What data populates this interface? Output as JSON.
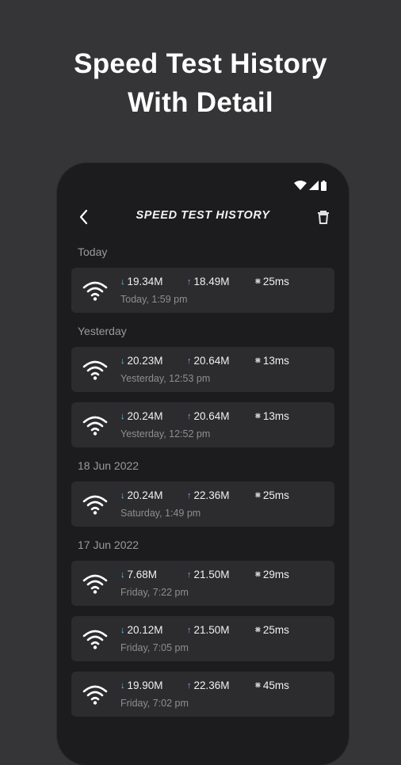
{
  "headline": {
    "line1": "Speed Test History",
    "line2": "With Detail"
  },
  "app": {
    "title": "SPEED TEST HISTORY"
  },
  "groups": [
    {
      "label": "Today",
      "entries": [
        {
          "download": "19.34M",
          "upload": "18.49M",
          "ping": "25ms",
          "timestamp": "Today, 1:59 pm"
        }
      ]
    },
    {
      "label": "Yesterday",
      "entries": [
        {
          "download": "20.23M",
          "upload": "20.64M",
          "ping": "13ms",
          "timestamp": "Yesterday, 12:53 pm"
        },
        {
          "download": "20.24M",
          "upload": "20.64M",
          "ping": "13ms",
          "timestamp": "Yesterday, 12:52 pm"
        }
      ]
    },
    {
      "label": "18 Jun 2022",
      "entries": [
        {
          "download": "20.24M",
          "upload": "22.36M",
          "ping": "25ms",
          "timestamp": "Saturday, 1:49 pm"
        }
      ]
    },
    {
      "label": "17 Jun 2022",
      "entries": [
        {
          "download": "7.68M",
          "upload": "21.50M",
          "ping": "29ms",
          "timestamp": "Friday, 7:22 pm"
        },
        {
          "download": "20.12M",
          "upload": "21.50M",
          "ping": "25ms",
          "timestamp": "Friday, 7:05 pm"
        },
        {
          "download": "19.90M",
          "upload": "22.36M",
          "ping": "45ms",
          "timestamp": "Friday, 7:02 pm"
        }
      ]
    }
  ],
  "icons": {
    "back": "chevron-left-icon",
    "delete": "trash-icon",
    "entry": "wifi-icon",
    "download": "arrow-down-icon",
    "upload": "arrow-up-icon",
    "ping": "ping-icon"
  },
  "colors": {
    "background": "#353537",
    "phone": "#1c1c1e",
    "card": "#2c2c2e",
    "download": "#6ec6e8",
    "upload": "#c983e8"
  }
}
